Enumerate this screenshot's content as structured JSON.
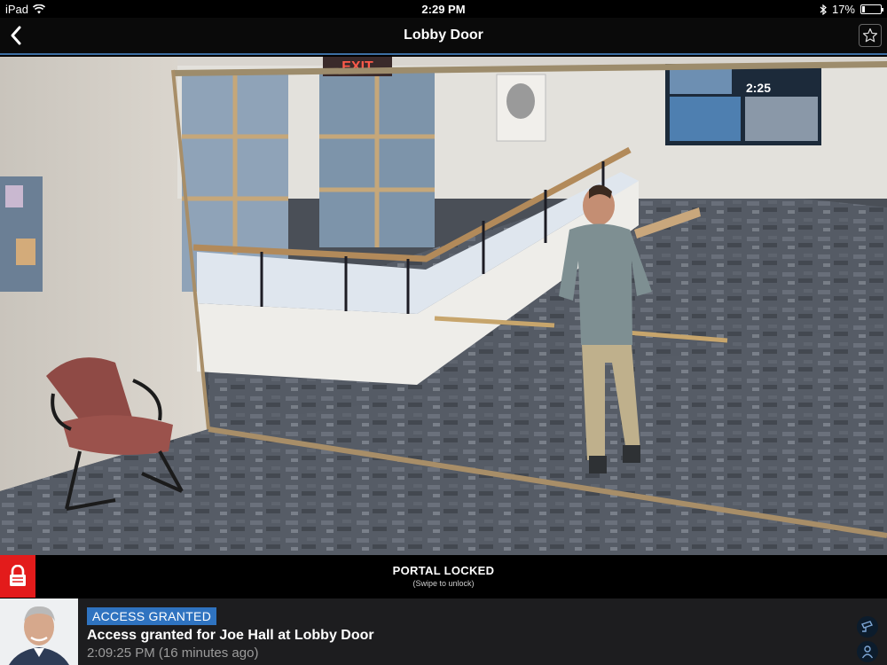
{
  "status_bar": {
    "device": "iPad",
    "time": "2:29 PM",
    "battery_percent": "17%",
    "battery_level": 0.17
  },
  "nav": {
    "title": "Lobby Door",
    "back_icon": "chevron-left-icon",
    "favorite_icon": "star-icon"
  },
  "camera": {
    "exit_sign": "EXIT",
    "tv_number": "2:25"
  },
  "portal": {
    "status": "PORTAL LOCKED",
    "hint": "(Swipe to unlock)",
    "lock_color": "#e31b1b"
  },
  "event": {
    "badge": "ACCESS GRANTED",
    "title": "Access granted for Joe Hall at Lobby Door",
    "time": "2:09:25 PM (16 minutes ago)",
    "badge_color": "#2f73c0"
  }
}
